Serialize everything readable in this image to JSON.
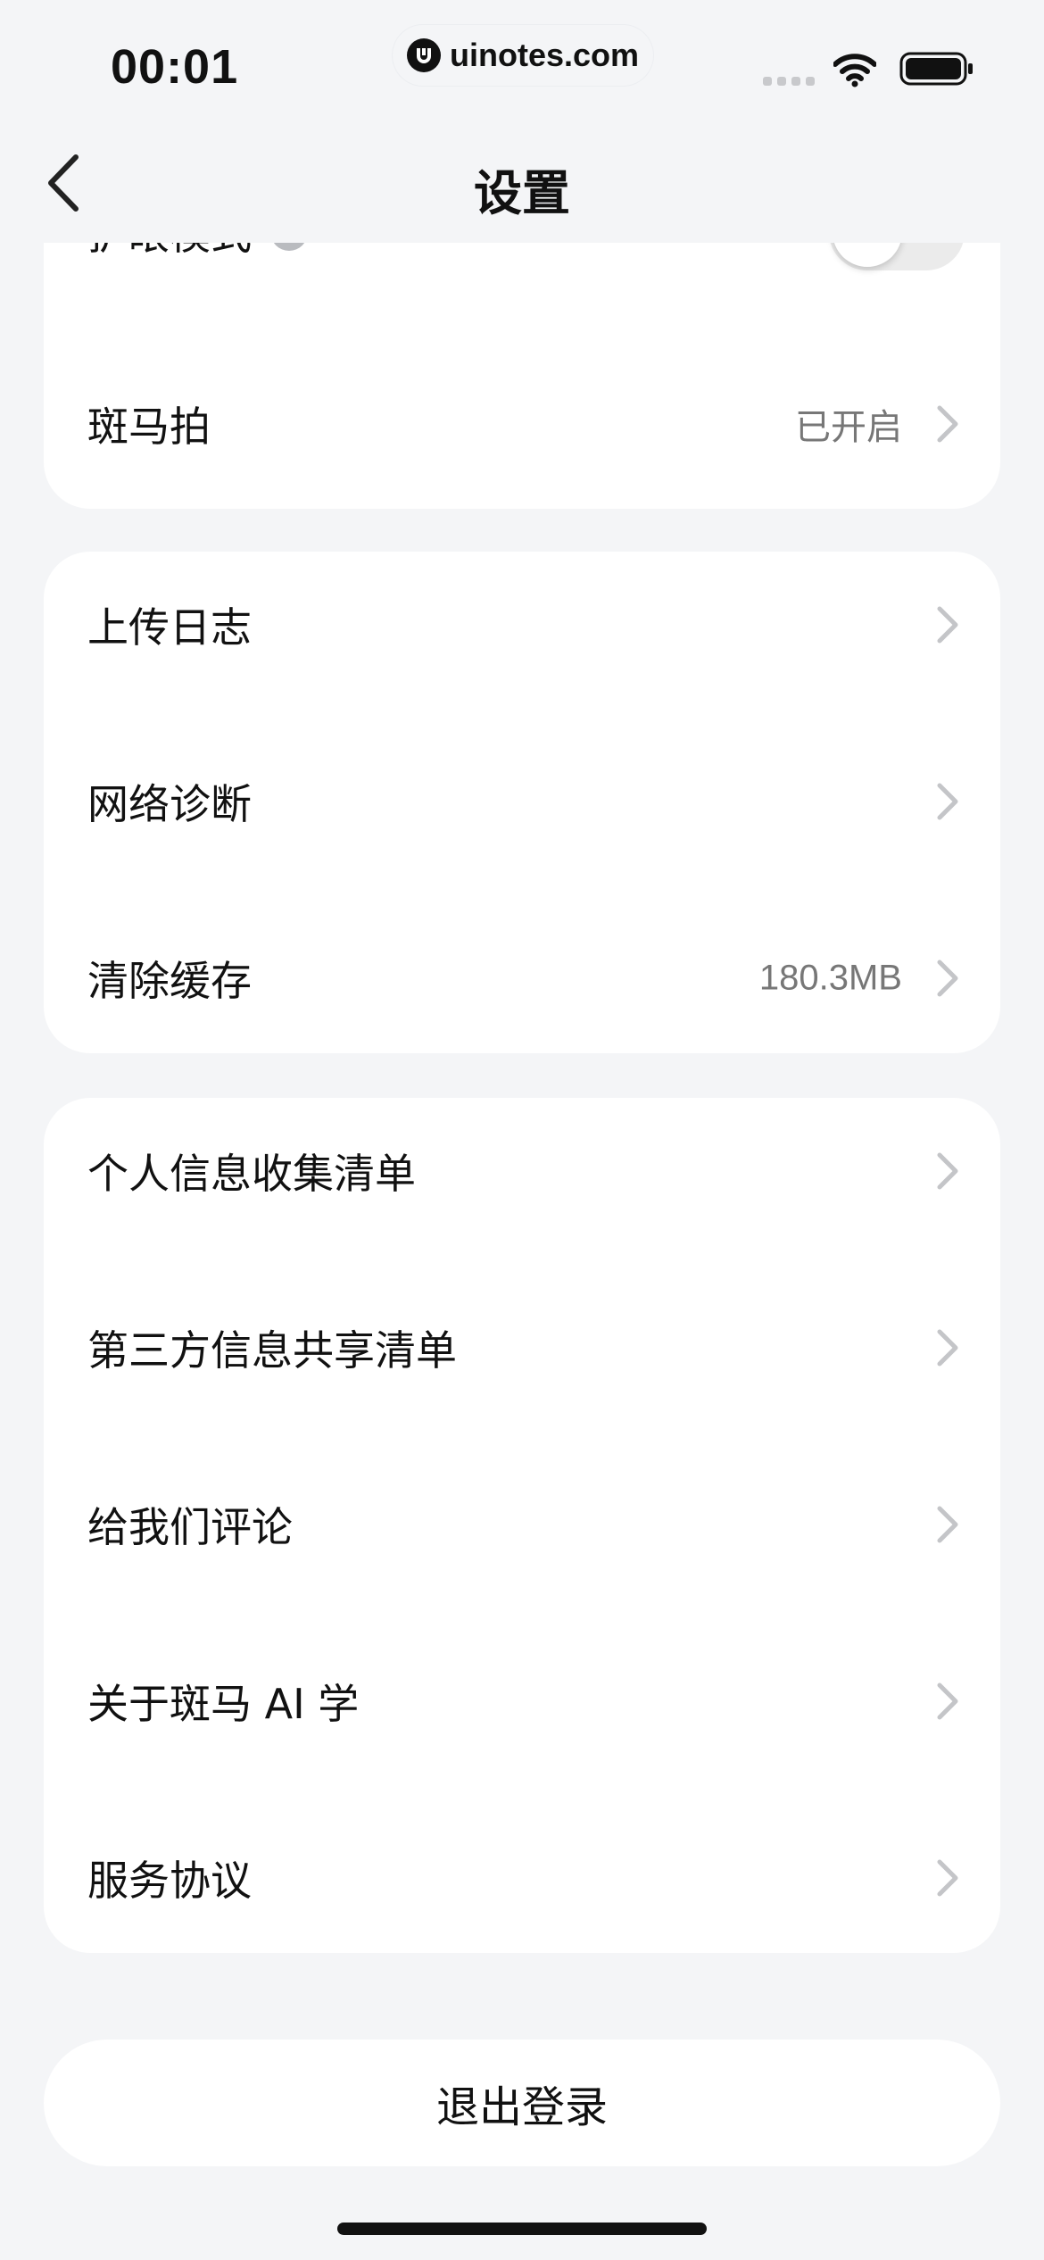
{
  "status_bar": {
    "time": "00:01",
    "url": "uinotes.com"
  },
  "nav": {
    "title": "设置"
  },
  "group1": {
    "eye_mode_label": "护眼模式",
    "eye_mode_on": false,
    "zebra_pai_label": "斑马拍",
    "zebra_pai_value": "已开启"
  },
  "group2": {
    "upload_log_label": "上传日志",
    "network_diag_label": "网络诊断",
    "clear_cache_label": "清除缓存",
    "cache_size": "180.3MB"
  },
  "group3": {
    "personal_info_label": "个人信息收集清单",
    "third_party_label": "第三方信息共享清单",
    "review_label": "给我们评论",
    "about_label": "关于斑马 AI 学",
    "service_label": "服务协议"
  },
  "logout": {
    "label": "退出登录"
  },
  "colors": {
    "background": "#f4f5f7",
    "card": "#ffffff",
    "secondary_text": "#777777",
    "chevron": "#c4c5c8"
  }
}
